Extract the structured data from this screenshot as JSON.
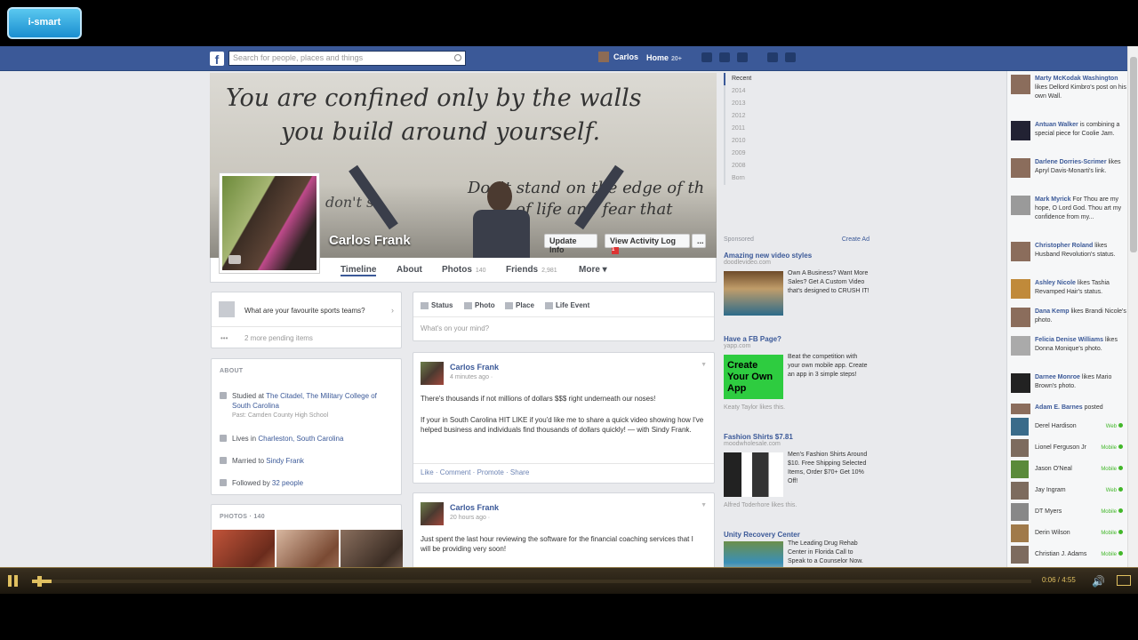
{
  "search": {
    "placeholder": "Search for people, places and things"
  },
  "header": {
    "user_name": "Carlos",
    "home_label": "Home",
    "home_count": "20+"
  },
  "overlay_logo": "i-smart",
  "cover": {
    "quote_line1": "You are confined only by the walls",
    "quote_line2": "you build around yourself.",
    "quote_back1": "Don't stand on the edge of th",
    "quote_back2": "of life and fear that",
    "quote_back3": "don't sc",
    "name": "Carlos Frank",
    "update_info": "Update Info",
    "view_activity": "View Activity Log",
    "activity_count": "1",
    "more_dots": "..."
  },
  "tabs": [
    {
      "label": "Timeline",
      "count": ""
    },
    {
      "label": "About",
      "count": ""
    },
    {
      "label": "Photos",
      "count": "140"
    },
    {
      "label": "Friends",
      "count": "2,981"
    },
    {
      "label": "More ▾",
      "count": ""
    }
  ],
  "sports": {
    "question": "What are your favourite sports teams?",
    "chevron": "›",
    "dots": "•••",
    "pending": "2 more pending items"
  },
  "about": {
    "heading": "ABOUT",
    "studied_prefix": "Studied at ",
    "studied_school": "The Citadel, The Military College of South Carolina",
    "past_school": "Past: Camden County High School",
    "lives_prefix": "Lives in ",
    "lives_city": "Charleston, South Carolina",
    "married_prefix": "Married to ",
    "married_name": "Sindy Frank",
    "followed_prefix": "Followed by ",
    "followed_count": "32 people"
  },
  "photos": {
    "heading": "PHOTOS · 140"
  },
  "composer": {
    "tabs": [
      "Status",
      "Photo",
      "Place",
      "Life Event"
    ],
    "placeholder": "What's on your mind?"
  },
  "posts": [
    {
      "name": "Carlos Frank",
      "time": "4 minutes ago ·",
      "line1": "There's thousands if not millions of dollars $$$ right underneath our noses!",
      "line2": "If your in South Carolina HIT LIKE if you'd like me to share a quick video showing how I've helped business and individuals find thousands of dollars quickly! — with Sindy Frank.",
      "actions": "Like · Comment · Promote · Share"
    },
    {
      "name": "Carlos Frank",
      "time": "20 hours ago ·",
      "line1": "Just spent the last hour reviewing the software for the financial coaching services that I will be providing very soon!",
      "line2": "",
      "actions": ""
    }
  ],
  "years": [
    "Recent",
    "2014",
    "2013",
    "2012",
    "2011",
    "2010",
    "2009",
    "2008",
    "Born"
  ],
  "sponsored": {
    "label": "Sponsored",
    "create_ad": "Create Ad",
    "ads": [
      {
        "title": "Amazing new video styles",
        "url": "doodlevideo.com",
        "desc": "Own A Business? Want More Sales? Get A Custom Video that's designed to CRUSH IT!",
        "likes": ""
      },
      {
        "title": "Have a FB Page?",
        "url": "yapp.com",
        "desc": "Beat the competition with your own mobile app. Create an app in 3 simple steps!",
        "likes": "Keaty Taylor likes this.",
        "img_text": "Create Your Own App"
      },
      {
        "title": "Fashion Shirts $7.81",
        "url": "moodwholesale.com",
        "desc": "Men's Fashion Shirts Around $10. Free Shipping Selected Items, Order $70+ Get 10% Off!",
        "likes": "Alfred Toderhore likes this."
      },
      {
        "title": "Unity Recovery Center",
        "url": "",
        "desc": "The Leading Drug Rehab Center in Florida Call to Speak to a Counselor Now.",
        "likes": ""
      }
    ]
  },
  "ticker": [
    {
      "name": "Marty McKodak Washington",
      "text": "likes Dellord Kimbro's post on his own Wall."
    },
    {
      "name": "Antuan Walker",
      "text": "is combining a special piece for Coolie Jam."
    },
    {
      "name": "Darlene Dorries-Scrimer",
      "text": "likes Apryl Davis-Monarti's link."
    },
    {
      "name": "Mark Myrick",
      "text": "For Thou are my hope, O Lord God. Thou art my confidence from my..."
    },
    {
      "name": "Christopher Roland",
      "text": "likes Husband Revolution's status."
    },
    {
      "name": "Ashley Nicole",
      "text": "likes Tashia Revamped Hair's status."
    },
    {
      "name": "Dana Kemp",
      "text": "likes Brandi Nicole's photo."
    },
    {
      "name": "Felicia Denise Williams",
      "text": "likes Donna Monique's photo."
    },
    {
      "name": "Darnee Monroe",
      "text": "likes Mario Brown's photo."
    },
    {
      "name": "Adam E. Barnes",
      "text": "posted"
    }
  ],
  "chat": [
    {
      "name": "Derel Hardison",
      "status": "Web"
    },
    {
      "name": "Lionel Ferguson Jr",
      "status": "Mobile"
    },
    {
      "name": "Jason O'Neal",
      "status": "Mobile"
    },
    {
      "name": "Jay Ingram",
      "status": "Web"
    },
    {
      "name": "DT Myers",
      "status": "Mobile"
    },
    {
      "name": "Derin Wilson",
      "status": "Mobile"
    },
    {
      "name": "Christian J. Adams",
      "status": "Mobile"
    }
  ],
  "player": {
    "time": "0:06 / 4:55",
    "progress": 0.02
  }
}
